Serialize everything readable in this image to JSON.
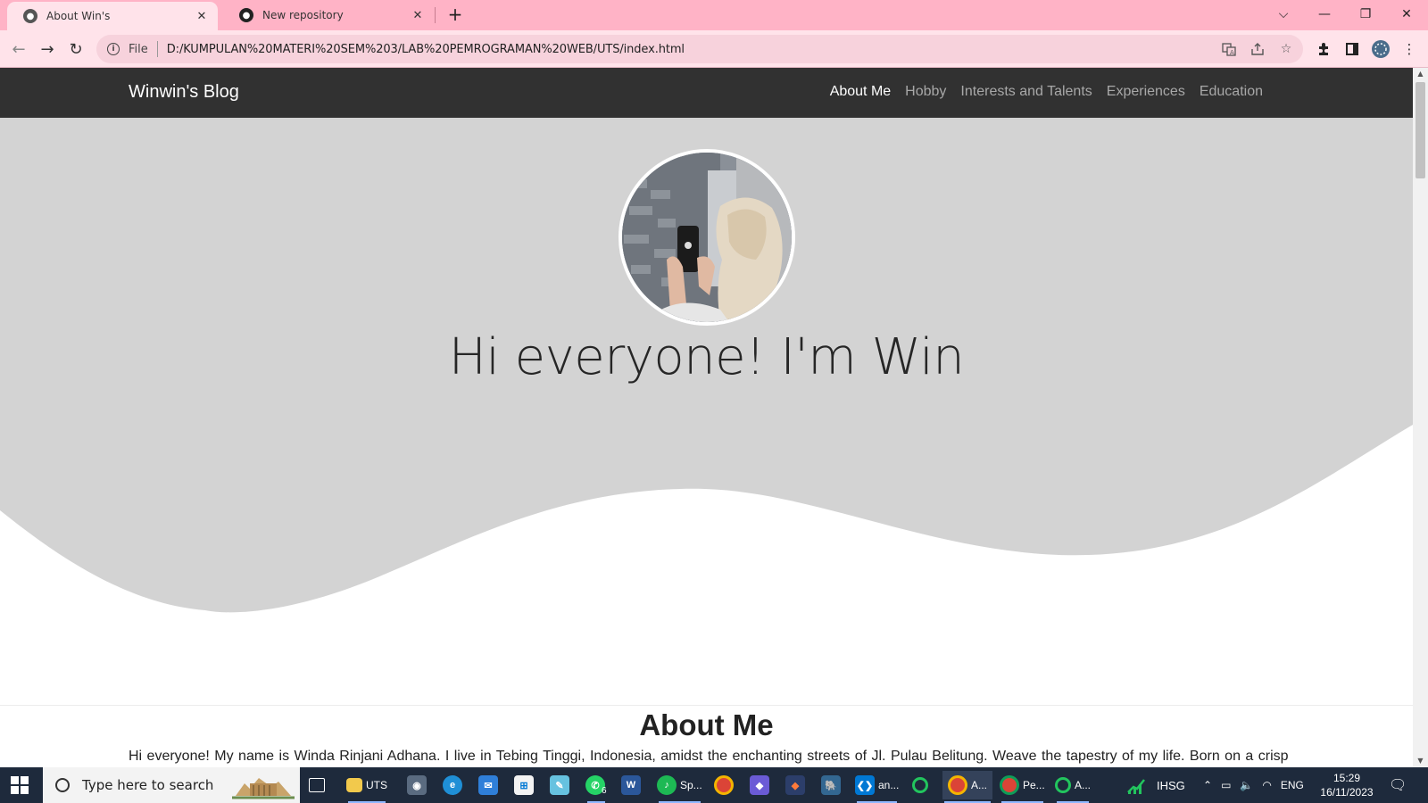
{
  "browser": {
    "tabs": [
      {
        "title": "About Win's",
        "icon": "globe-icon"
      },
      {
        "title": "New repository",
        "icon": "github-icon"
      }
    ],
    "new_tab_symbol": "+",
    "window_controls": {
      "tab_search": "⌵",
      "minimize": "—",
      "restore": "❐",
      "close": "✕"
    },
    "address_bar": {
      "scheme_label": "File",
      "url": "D:/KUMPULAN%20MATERI%20SEM%203/LAB%20PEMROGRAMAN%20WEB/UTS/index.html"
    },
    "nav": {
      "back": "←",
      "forward": "→",
      "reload": "↻"
    },
    "toolbar_icons": [
      "translate-icon",
      "share-icon",
      "star-icon",
      "extensions-icon",
      "sidepanel-icon",
      "profile-icon",
      "menu-icon"
    ]
  },
  "site": {
    "brand": "Winwin's Blog",
    "nav_links": [
      {
        "label": "About Me",
        "active": true
      },
      {
        "label": "Hobby",
        "active": false
      },
      {
        "label": "Interests and Talents",
        "active": false
      },
      {
        "label": "Experiences",
        "active": false
      },
      {
        "label": "Education",
        "active": false
      }
    ],
    "hero": {
      "title": "Hi everyone! I'm Win",
      "background": "#d3d3d3"
    },
    "about": {
      "title": "About Me",
      "text": "Hi everyone! My name is Winda Rinjani Adhana. I live in Tebing Tinggi, Indonesia, amidst the enchanting streets of Jl. Pulau Belitung. Weave the tapestry of my life. Born on a crisp"
    },
    "colors": {
      "navbar": "#313131",
      "nav_active": "#ffffff",
      "nav_inactive": "#a8a8a8",
      "hero_bg": "#d3d3d3"
    }
  },
  "taskbar": {
    "search_placeholder": "Type here to search",
    "apps": [
      {
        "label": "UTS",
        "icon": "folder-icon"
      },
      {
        "label": "",
        "icon": "camera-icon"
      },
      {
        "label": "",
        "icon": "edge-icon"
      },
      {
        "label": "",
        "icon": "mail-icon"
      },
      {
        "label": "",
        "icon": "store-icon"
      },
      {
        "label": "",
        "icon": "notes-icon"
      },
      {
        "label": "6",
        "icon": "whatsapp-icon"
      },
      {
        "label": "",
        "icon": "word-icon"
      },
      {
        "label": "Sp...",
        "icon": "spotify-icon"
      },
      {
        "label": "",
        "icon": "chrome-icon"
      },
      {
        "label": "",
        "icon": "app-icon"
      },
      {
        "label": "",
        "icon": "git-icon"
      },
      {
        "label": "",
        "icon": "postgres-icon"
      },
      {
        "label": "an...",
        "icon": "vscode-icon"
      },
      {
        "label": "",
        "icon": "loader-icon"
      },
      {
        "label": "A...",
        "icon": "chrome-icon"
      },
      {
        "label": "Pe...",
        "icon": "chrome-icon"
      },
      {
        "label": "A...",
        "icon": "loader-icon"
      }
    ],
    "stock_widget": "IHSG",
    "tray": {
      "language": "ENG"
    },
    "clock": {
      "time": "15:29",
      "date": "16/11/2023"
    }
  }
}
